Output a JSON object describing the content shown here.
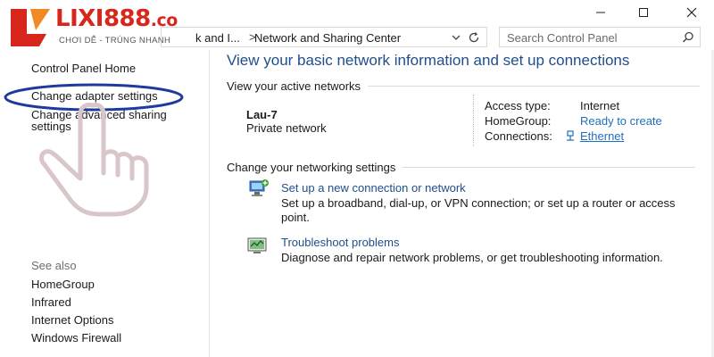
{
  "address_bar": {
    "crumb_parent": "k and I...",
    "separator": ">",
    "crumb_current": "Network and Sharing Center"
  },
  "search": {
    "placeholder": "Search Control Panel"
  },
  "logo": {
    "name": "LIXI888",
    "tld": ".co",
    "tagline": "CHƠI DỄ - TRÚNG NHANH",
    "brand_color": "#d9261c"
  },
  "sidebar": {
    "home": "Control Panel Home",
    "change_adapter": "Change adapter settings",
    "change_advanced_line1": "Change advanced sharing",
    "change_advanced_line2": "settings",
    "see_also": "See also",
    "see_also_items": [
      "HomeGroup",
      "Infrared",
      "Internet Options",
      "Windows Firewall"
    ]
  },
  "main": {
    "title": "View your basic network information and set up connections",
    "active_networks_heading": "View your active networks",
    "network": {
      "name": "Lau-7",
      "type": "Private network",
      "access_type_label": "Access type:",
      "access_type_value": "Internet",
      "homegroup_label": "HomeGroup:",
      "homegroup_value": "Ready to create",
      "connections_label": "Connections:",
      "connections_value": "Ethernet"
    },
    "change_settings_heading": "Change your networking settings",
    "tasks": [
      {
        "link": "Set up a new connection or network",
        "desc": "Set up a broadband, dial-up, or VPN connection; or set up a router or access point.",
        "icon": "new-connection-icon"
      },
      {
        "link": "Troubleshoot problems",
        "desc": "Diagnose and repair network problems, or get troubleshooting information.",
        "icon": "troubleshoot-icon"
      }
    ]
  },
  "colors": {
    "title_blue": "#1e4e8c",
    "link_blue": "#1f6fbf",
    "highlight_ring": "#1f3a9c"
  }
}
